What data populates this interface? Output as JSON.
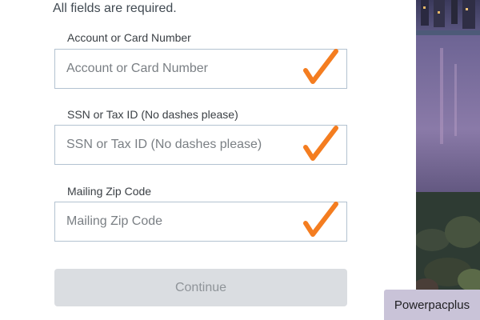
{
  "form": {
    "required_note": "All fields are required.",
    "fields": [
      {
        "label": "Account or Card Number",
        "placeholder": "Account or Card Number",
        "value": "",
        "valid": true
      },
      {
        "label": "SSN or Tax ID (No dashes please)",
        "placeholder": "SSN or Tax ID (No dashes please)",
        "value": "",
        "valid": true
      },
      {
        "label": "Mailing Zip Code",
        "placeholder": "Mailing Zip Code",
        "value": "",
        "valid": true
      }
    ],
    "continue_label": "Continue",
    "continue_enabled": false
  },
  "icons": {
    "valid_indicator": "checkmark-icon"
  },
  "colors": {
    "checkmark": "#f47d20",
    "input_border": "#b3c2d1",
    "button_disabled_bg": "#dadde1",
    "button_disabled_text": "#8f9499",
    "badge_bg": "#c9c3d8"
  },
  "badge": {
    "text": "Powerpacplus"
  }
}
